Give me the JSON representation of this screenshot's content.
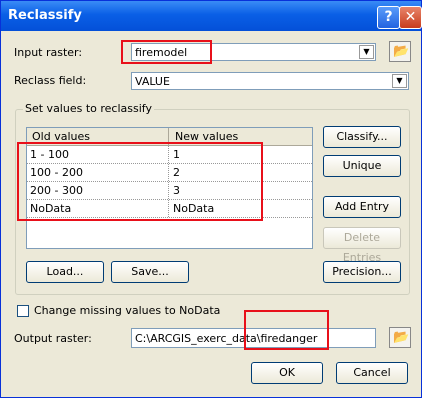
{
  "window": {
    "title": "Reclassify",
    "help_glyph": "?",
    "close_glyph": "✕"
  },
  "input_raster": {
    "label": "Input raster:",
    "value": "firemodel"
  },
  "reclass_field": {
    "label": "Reclass field:",
    "value": "VALUE"
  },
  "group": {
    "title": "Set values to reclassify"
  },
  "table": {
    "headers": [
      "Old values",
      "New values"
    ],
    "rows": [
      {
        "old": "1 - 100",
        "new": "1"
      },
      {
        "old": "100 - 200",
        "new": "2"
      },
      {
        "old": "200 - 300",
        "new": "3"
      },
      {
        "old": "NoData",
        "new": "NoData"
      }
    ]
  },
  "buttons": {
    "classify": "Classify...",
    "unique": "Unique",
    "add_entry": "Add Entry",
    "delete_entries": "Delete Entries",
    "load": "Load...",
    "save": "Save...",
    "precision": "Precision...",
    "ok": "OK",
    "cancel": "Cancel"
  },
  "change_missing": {
    "label": "Change missing values to NoData",
    "checked": false
  },
  "output_raster": {
    "label": "Output raster:",
    "value": "C:\\ARCGIS_exerc_data\\firedanger"
  },
  "icons": {
    "dropdown": "chevron-down-icon",
    "folder": "folder-open-icon"
  }
}
